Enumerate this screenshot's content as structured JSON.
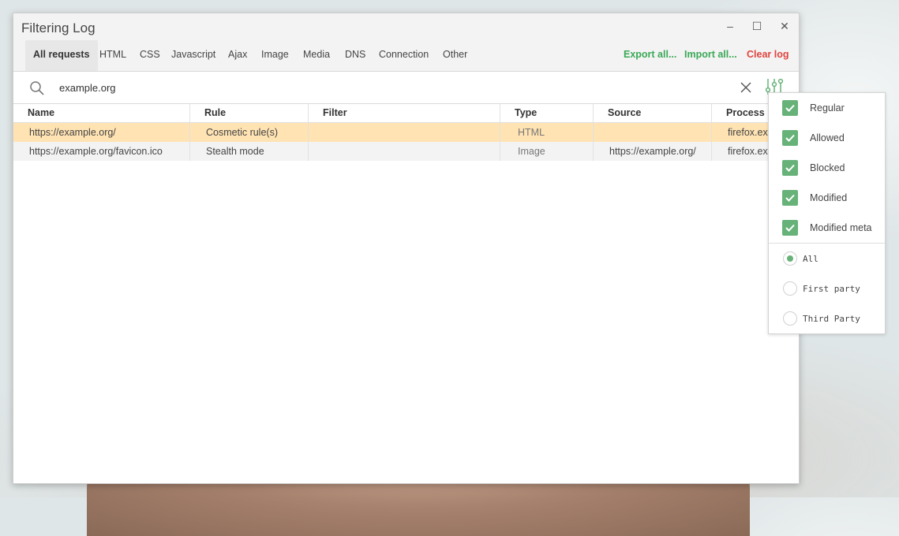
{
  "window": {
    "title": "Filtering Log",
    "minimize_glyph": "–",
    "maximize_glyph": "☐",
    "close_glyph": "✕"
  },
  "tabs": [
    {
      "label": "All requests",
      "active": true
    },
    {
      "label": "HTML"
    },
    {
      "label": "CSS"
    },
    {
      "label": "Javascript"
    },
    {
      "label": "Ajax"
    },
    {
      "label": "Image"
    },
    {
      "label": "Media"
    },
    {
      "label": "DNS"
    },
    {
      "label": "Connection"
    },
    {
      "label": "Other"
    }
  ],
  "actions": {
    "export": "Export all...",
    "import": "Import all...",
    "clear": "Clear log"
  },
  "colors": {
    "accent_green": "#3aa856",
    "clear_red": "#e0443f",
    "highlight_row": "#ffe3b3",
    "checkbox_green": "#67b279"
  },
  "search": {
    "value": "example.org",
    "icon": "search-icon",
    "clear_icon": "close-icon",
    "filter_icon": "filter-sliders-icon"
  },
  "table": {
    "columns": [
      "Name",
      "Rule",
      "Filter",
      "Type",
      "Source",
      "Process"
    ],
    "rows": [
      {
        "name": "https://example.org/",
        "rule": "Cosmetic rule(s)",
        "filter": "",
        "type": "HTML",
        "source": "",
        "process": "firefox.exe",
        "highlight": true
      },
      {
        "name": "https://example.org/favicon.ico",
        "rule": "Stealth mode",
        "filter": "",
        "type": "Image",
        "source": "https://example.org/",
        "process": "firefox.exe"
      }
    ]
  },
  "filter_popup": {
    "checkboxes": [
      {
        "label": "Regular",
        "checked": true
      },
      {
        "label": "Allowed",
        "checked": true
      },
      {
        "label": "Blocked",
        "checked": true
      },
      {
        "label": "Modified",
        "checked": true
      },
      {
        "label": "Modified meta",
        "checked": true
      }
    ],
    "radios": [
      {
        "label": "All",
        "selected": true
      },
      {
        "label": "First party",
        "selected": false
      },
      {
        "label": "Third Party",
        "selected": false
      }
    ]
  }
}
